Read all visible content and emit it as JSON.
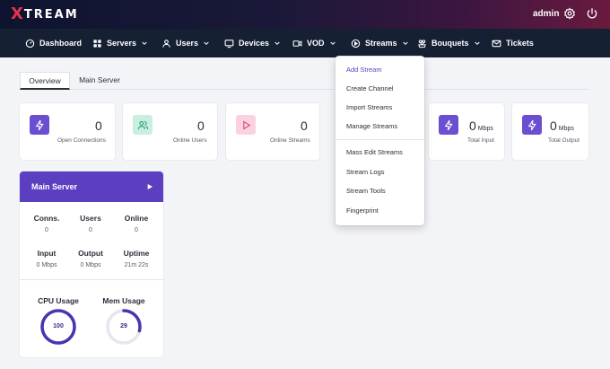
{
  "brand": {
    "logo_x": "X",
    "logo_text": "TREAM"
  },
  "topbar": {
    "user": "admin",
    "gear_icon": "gear-icon",
    "power_icon": "power-icon"
  },
  "nav": {
    "items": [
      {
        "label": "Dashboard",
        "icon": "dashboard-icon"
      },
      {
        "label": "Servers",
        "icon": "servers-icon"
      },
      {
        "label": "Users",
        "icon": "user-icon"
      },
      {
        "label": "Devices",
        "icon": "monitor-icon"
      },
      {
        "label": "VOD",
        "icon": "video-icon"
      },
      {
        "label": "Streams",
        "icon": "play-circle-icon"
      },
      {
        "label": "Bouquets",
        "icon": "bouquet-icon"
      },
      {
        "label": "Tickets",
        "icon": "mail-icon"
      }
    ]
  },
  "tabs": [
    {
      "label": "Overview",
      "active": true
    },
    {
      "label": "Main Server",
      "active": false
    }
  ],
  "stats": [
    {
      "value": "0",
      "unit": "",
      "label": "Open Connections",
      "icon": "lightning-icon",
      "color": "#6b4fd0"
    },
    {
      "value": "0",
      "unit": "",
      "label": "Online Users",
      "icon": "users-icon",
      "color": "#c9efe0"
    },
    {
      "value": "0",
      "unit": "",
      "label": "Online Streams",
      "icon": "play-icon",
      "color": "#fbd3e0"
    },
    {
      "value": "0",
      "unit": "Mbps",
      "label": "Total Input",
      "icon": "lightning-icon",
      "color": "#6b4fd0"
    },
    {
      "value": "0",
      "unit": "Mbps",
      "label": "Total Output",
      "icon": "lightning-icon",
      "color": "#6b4fd0"
    }
  ],
  "server": {
    "title": "Main Server",
    "metrics": [
      {
        "label": "Conns.",
        "value": "0"
      },
      {
        "label": "Users",
        "value": "0"
      },
      {
        "label": "Online",
        "value": "0"
      },
      {
        "label": "Input",
        "value": "0 Mbps"
      },
      {
        "label": "Output",
        "value": "0 Mbps"
      },
      {
        "label": "Uptime",
        "value": "21m 22s"
      }
    ],
    "gauges": [
      {
        "label": "CPU Usage",
        "value": "100",
        "percent": 100
      },
      {
        "label": "Mem Usage",
        "value": "29",
        "percent": 29
      }
    ],
    "accent": "#5b3fc0"
  },
  "streams_menu": {
    "items": [
      {
        "label": "Add Stream",
        "active": true
      },
      {
        "label": "Create Channel"
      },
      {
        "label": "Import Streams"
      },
      {
        "label": "Manage Streams"
      },
      {
        "label": "Mass Edit Streams"
      },
      {
        "label": "Stream Logs"
      },
      {
        "label": "Stream Tools"
      },
      {
        "label": "Fingerprint"
      }
    ]
  },
  "colors": {
    "nav_bg": "#152033",
    "accent": "#5b3fc0",
    "logo_red": "#e8334a"
  }
}
